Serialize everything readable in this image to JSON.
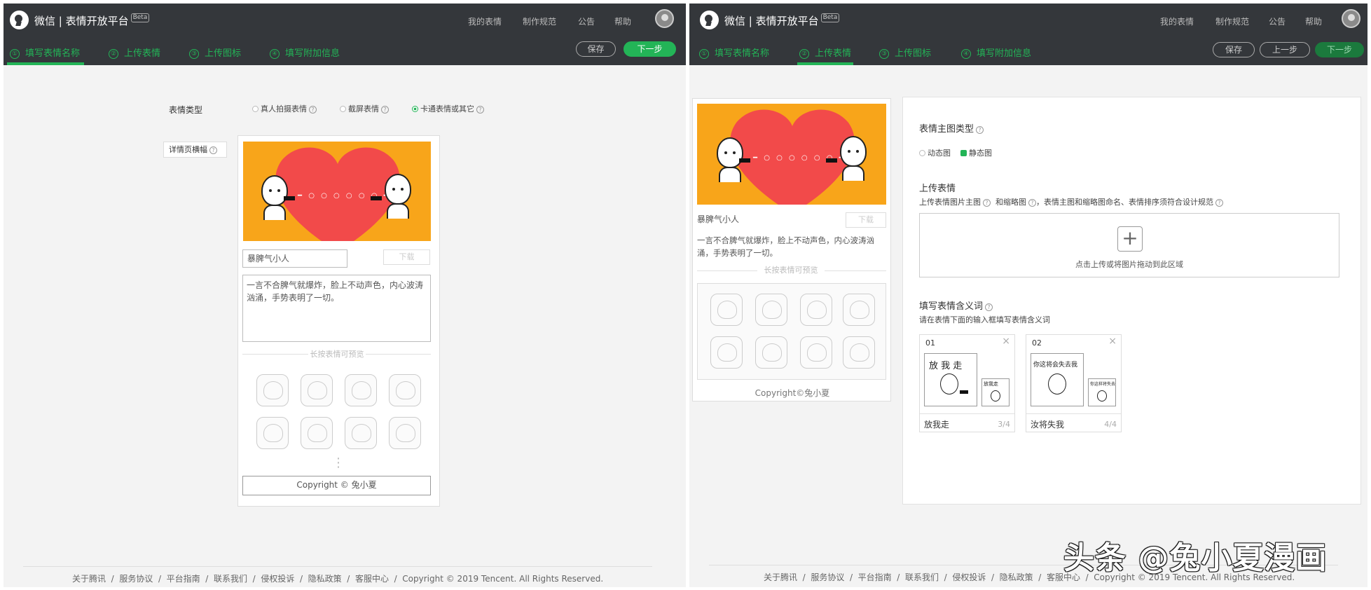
{
  "header": {
    "brand": "微信 | 表情开放平台",
    "beta": "Beta",
    "nav": [
      "我的表情",
      "制作规范",
      "公告",
      "帮助"
    ]
  },
  "steps": [
    "填写表情名称",
    "上传表情",
    "上传图标",
    "填写附加信息"
  ],
  "step_numbers": [
    "①",
    "②",
    "③",
    "④"
  ],
  "left": {
    "save": "保存",
    "next": "下一步",
    "type_label": "表情类型",
    "radios": [
      "真人拍摄表情",
      "截屏表情",
      "卡通表情或其它"
    ],
    "selected_radio": "卡通表情或其它",
    "banner_label": "详情页横幅",
    "name_value": "暴脾气小人",
    "download": "下载",
    "description": "一言不合脾气就爆炸，脸上不动声色，内心波涛汹涌，手势表明了一切。",
    "preview_hint": "长按表情可预览",
    "ellipsis": "⋮",
    "copyright": "Copyright © 兔小夏"
  },
  "right": {
    "save": "保存",
    "prev": "上一步",
    "next": "下一步",
    "phone_title": "暴脾气小人",
    "download": "下载",
    "description": "一言不合脾气就爆炸，脸上不动声色，内心波涛汹涌，手势表明了一切。",
    "preview_hint": "长按表情可预览",
    "copyright": "Copyright©兔小夏",
    "main_type_title": "表情主图类型",
    "type_options": [
      "动态图",
      "静态图"
    ],
    "selected_type": "静态图",
    "upload_title": "上传表情",
    "upload_desc_1": "上传表情图片主图",
    "upload_desc_2": "和缩略图",
    "upload_desc_3": "，表情主图和缩略图命名、表情排序须符合设计规范",
    "upload_hint": "点击上传或将图片拖动到此区域",
    "meaning_title": "填写表情含义词",
    "meaning_desc": "请在表情下面的输入框填写表情含义词",
    "cards": [
      {
        "num": "01",
        "word": "放我走",
        "count": "3/4",
        "caption": "放 我 走",
        "small": "放我走"
      },
      {
        "num": "02",
        "word": "汝将失我",
        "count": "4/4",
        "caption": "你这将会失去我",
        "small": "你这样将失去我"
      }
    ],
    "close": "×"
  },
  "footer": {
    "links": [
      "关于腾讯",
      "服务协议",
      "平台指南",
      "联系我们",
      "侵权投诉",
      "隐私政策",
      "客服中心"
    ],
    "copyright": "Copyright © 2019 Tencent. All Rights Reserved."
  },
  "watermark": "头条 @兔小夏漫画",
  "colors": {
    "accent": "#23b457",
    "topbar": "#34373b",
    "banner": "#f8a51a",
    "heart": "#f24a4a"
  }
}
